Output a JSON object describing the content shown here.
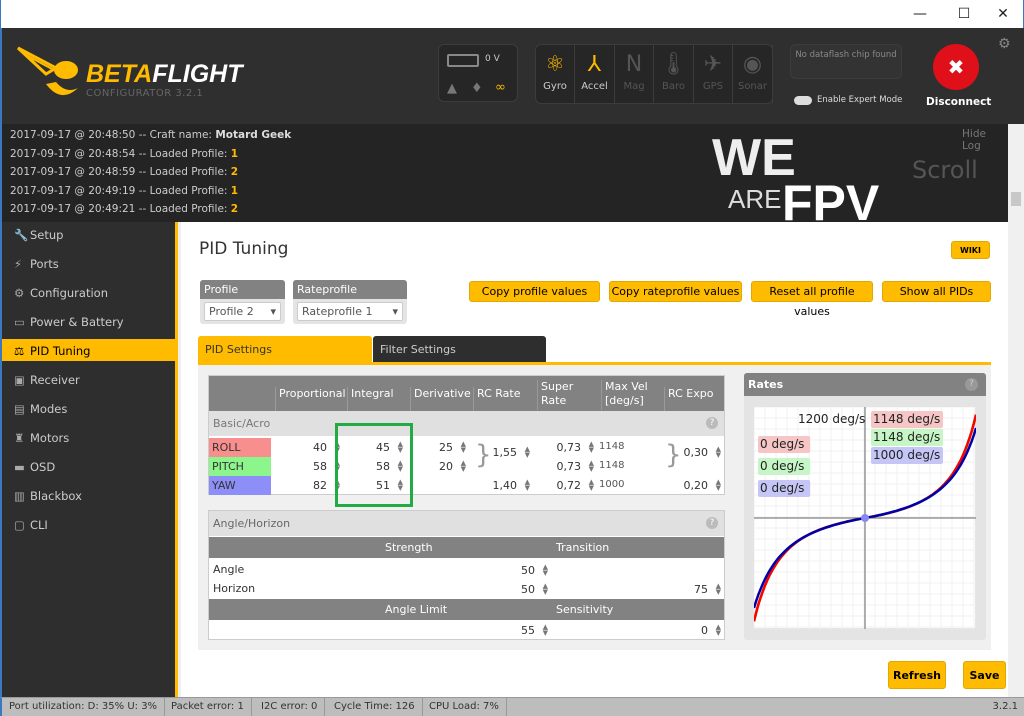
{
  "window": {
    "minimize": "—",
    "maximize": "☐",
    "close": "✕"
  },
  "header": {
    "logo_brand_a": "BETA",
    "logo_brand_b": "FLIGHT",
    "logo_sub": "CONFIGURATOR  3.2.1",
    "battery_voltage": "0 V",
    "sensors": [
      {
        "label": "Gyro",
        "icon": "gyro-icon",
        "active": true
      },
      {
        "label": "Accel",
        "icon": "accel-icon",
        "active": true
      },
      {
        "label": "Mag",
        "icon": "mag-icon",
        "active": false
      },
      {
        "label": "Baro",
        "icon": "baro-icon",
        "active": false
      },
      {
        "label": "GPS",
        "icon": "gps-icon",
        "active": false
      },
      {
        "label": "Sonar",
        "icon": "sonar-icon",
        "active": false
      }
    ],
    "dataflash": "No dataflash chip found",
    "expert_mode_label": "Enable Expert Mode",
    "expert_mode": false,
    "disconnect_label": "Disconnect"
  },
  "log": {
    "lines": [
      {
        "text": "2017-09-17 @ 20:48:50 -- Craft name: ",
        "value": "Motard Geek"
      },
      {
        "text": "2017-09-17 @ 20:48:54 -- Loaded Profile: ",
        "value": "1"
      },
      {
        "text": "2017-09-17 @ 20:48:59 -- Loaded Profile: ",
        "value": "2"
      },
      {
        "text": "2017-09-17 @ 20:49:19 -- Loaded Profile: ",
        "value": "1"
      },
      {
        "text": "2017-09-17 @ 20:49:21 -- Loaded Profile: ",
        "value": "2"
      }
    ],
    "hide_log": "Hide Log",
    "scroll": "Scroll",
    "watermark_a": "WE",
    "watermark_b": "ARE",
    "watermark_c": "FPV"
  },
  "sidebar": {
    "items": [
      {
        "label": "Setup",
        "icon": "wrench-icon",
        "glyph": "🔧"
      },
      {
        "label": "Ports",
        "icon": "plug-icon",
        "glyph": "⚡"
      },
      {
        "label": "Configuration",
        "icon": "gear-icon",
        "glyph": "⚙"
      },
      {
        "label": "Power & Battery",
        "icon": "battery-icon",
        "glyph": "▭"
      },
      {
        "label": "PID Tuning",
        "icon": "pid-icon",
        "glyph": "⚖",
        "active": true
      },
      {
        "label": "Receiver",
        "icon": "receiver-icon",
        "glyph": "▣"
      },
      {
        "label": "Modes",
        "icon": "modes-icon",
        "glyph": "▤"
      },
      {
        "label": "Motors",
        "icon": "motor-icon",
        "glyph": "♜"
      },
      {
        "label": "OSD",
        "icon": "osd-icon",
        "glyph": "▬"
      },
      {
        "label": "Blackbox",
        "icon": "blackbox-icon",
        "glyph": "▥"
      },
      {
        "label": "CLI",
        "icon": "cli-icon",
        "glyph": "▢"
      }
    ]
  },
  "main": {
    "title": "PID Tuning",
    "wiki": "WIKI",
    "profile_label": "Profile",
    "profile_value": "Profile 2",
    "rateprofile_label": "Rateprofile",
    "rateprofile_value": "Rateprofile 1",
    "buttons": {
      "copy_profile": "Copy profile values",
      "copy_rateprofile": "Copy rateprofile values",
      "reset": "Reset all profile values",
      "show_all": "Show all PIDs"
    },
    "tabs": [
      {
        "label": "PID Settings",
        "active": true
      },
      {
        "label": "Filter Settings",
        "active": false
      }
    ],
    "pid": {
      "headers": [
        "",
        "Proportional",
        "Integral",
        "Derivative",
        "RC Rate",
        "Super Rate",
        "Max Vel [deg/s]",
        "RC Expo"
      ],
      "section": "Basic/Acro",
      "rows": [
        {
          "axis": "ROLL",
          "color": "#f98e8e",
          "p": "40",
          "i": "45",
          "d": "25",
          "rc_rate": "1,55",
          "super_rate": "0,73",
          "max_vel": "1148",
          "rc_expo": "0,30"
        },
        {
          "axis": "PITCH",
          "color": "#8cf68c",
          "p": "58",
          "i": "58",
          "d": "20",
          "rc_rate": "",
          "super_rate": "0,73",
          "max_vel": "1148",
          "rc_expo": ""
        },
        {
          "axis": "YAW",
          "color": "#8e8ef9",
          "p": "82",
          "i": "51",
          "d": "",
          "rc_rate": "1,40",
          "super_rate": "0,72",
          "max_vel": "1000",
          "rc_expo": "0,20"
        }
      ]
    },
    "angle": {
      "section": "Angle/Horizon",
      "col_strength": "Strength",
      "col_transition": "Transition",
      "angle_label": "Angle",
      "angle_strength": "50",
      "horizon_label": "Horizon",
      "horizon_strength": "50",
      "horizon_transition": "75",
      "col_angle_limit": "Angle Limit",
      "col_sensitivity": "Sensitivity",
      "angle_limit": "55",
      "sensitivity": "0"
    },
    "rates": {
      "title": "Rates",
      "max_label": "1200 deg/s",
      "ylim": [
        -1200,
        1200
      ],
      "current": [
        "0 deg/s",
        "0 deg/s",
        "0 deg/s"
      ],
      "max": [
        "1148 deg/s",
        "1148 deg/s",
        "1000 deg/s"
      ],
      "colors": [
        "#ff0000",
        "#00cc00",
        "#0000aa"
      ]
    },
    "refresh": "Refresh",
    "save": "Save"
  },
  "status": {
    "port": "Port utilization: D: 35% U: 3%",
    "packet": "Packet error: 1",
    "i2c": "I2C error: 0",
    "cycle": "Cycle Time: 126",
    "cpu": "CPU Load: 7%",
    "version": "3.2.1"
  }
}
